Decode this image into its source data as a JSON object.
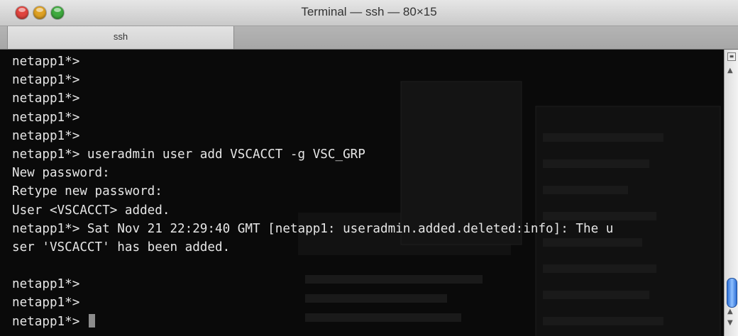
{
  "window": {
    "title": "Terminal — ssh — 80×15",
    "tabs": [
      {
        "label": "ssh"
      }
    ]
  },
  "terminal": {
    "lines": [
      "netapp1*>",
      "netapp1*>",
      "netapp1*>",
      "netapp1*>",
      "netapp1*>",
      "netapp1*> useradmin user add VSCACCT -g VSC_GRP",
      "New password:",
      "Retype new password:",
      "User <VSCACCT> added.",
      "netapp1*> Sat Nov 21 22:29:40 GMT [netapp1: useradmin.added.deleted:info]: The u",
      "ser 'VSCACCT' has been added.",
      "",
      "netapp1*>",
      "netapp1*>",
      "netapp1*> "
    ]
  },
  "colors": {
    "background": "#0a0a0a",
    "text": "#e6e6e6",
    "scroll_thumb": "#3a7be0"
  }
}
